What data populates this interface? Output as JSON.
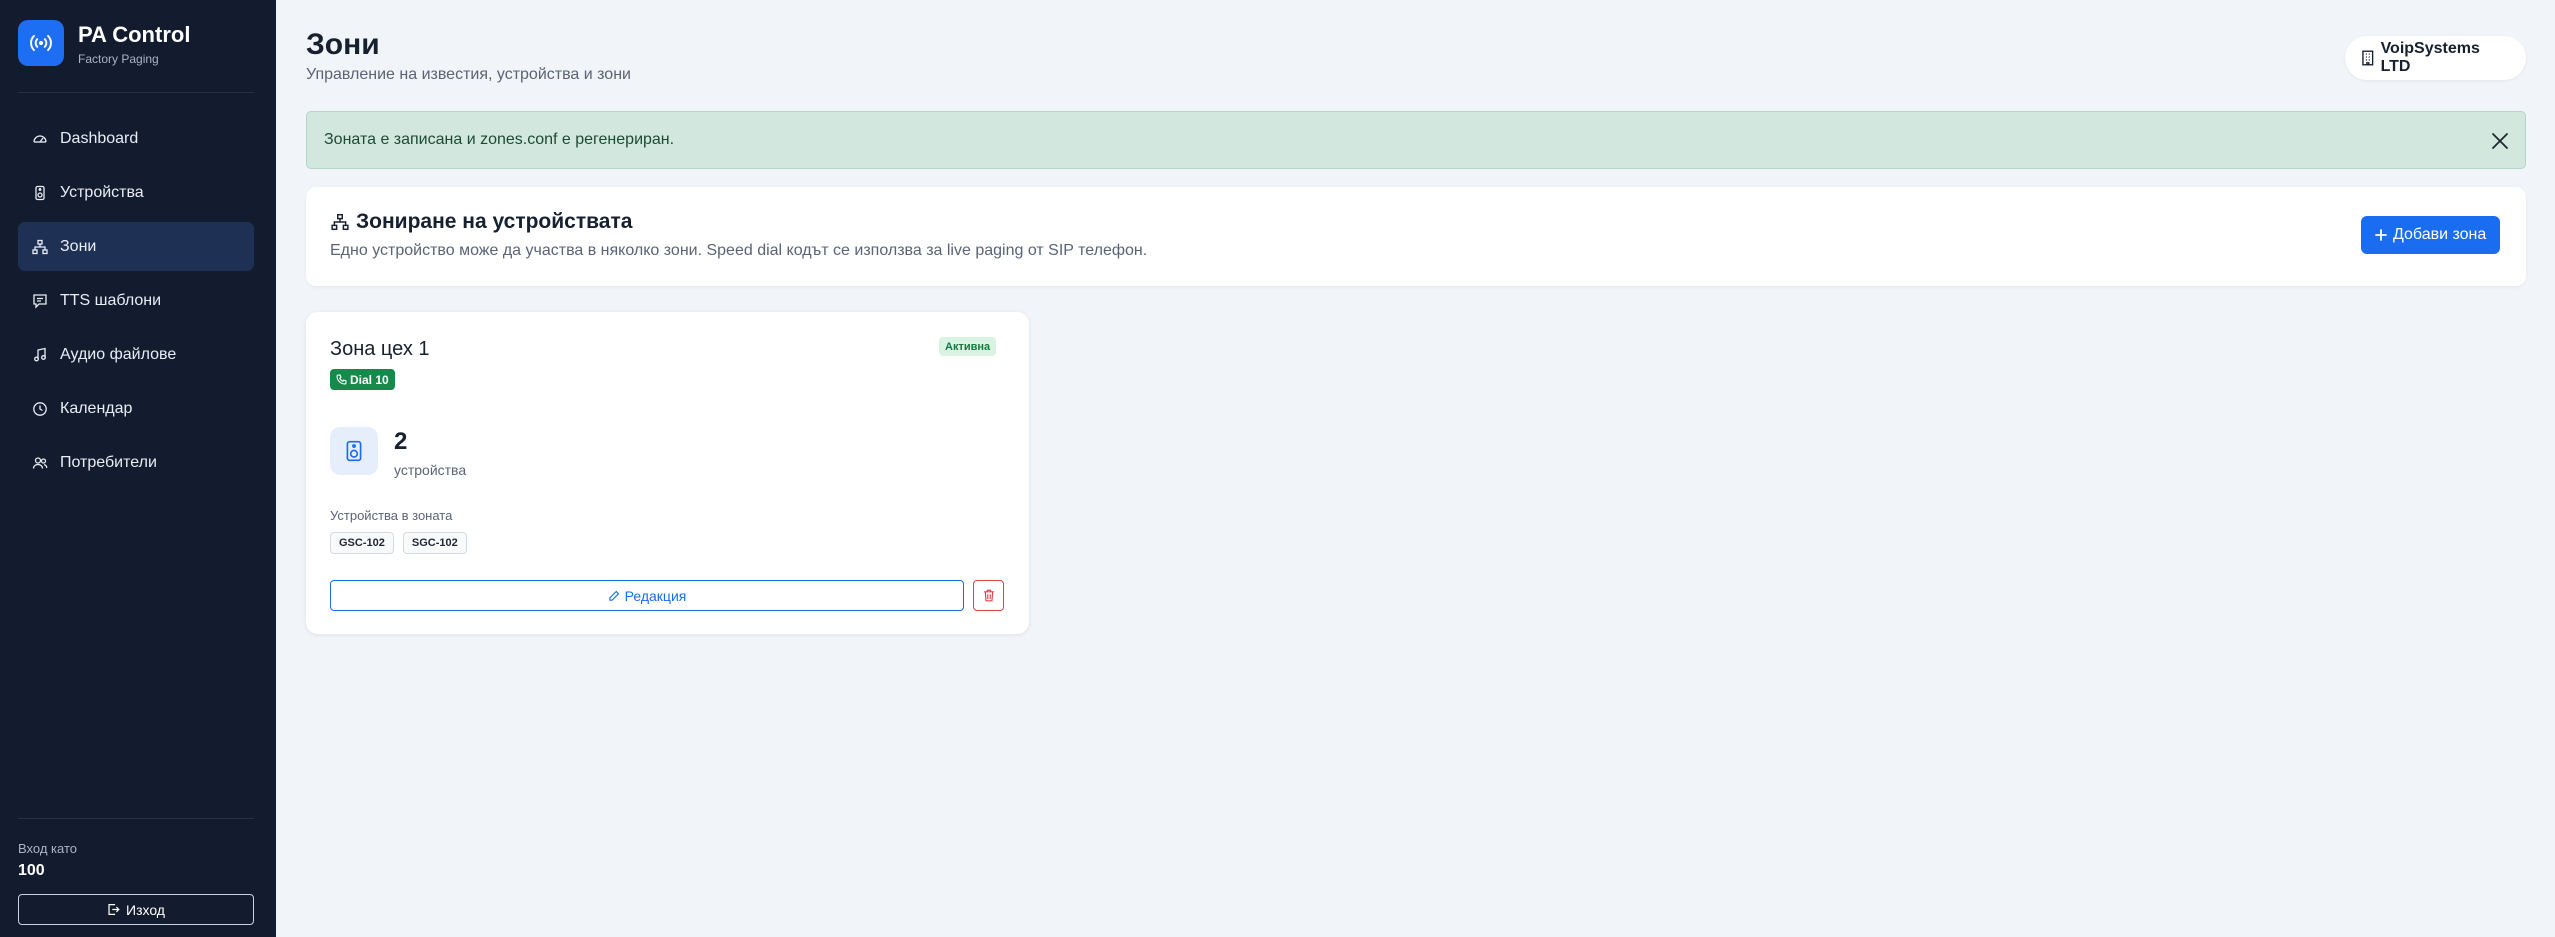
{
  "brand": {
    "title": "PA Control",
    "subtitle": "Factory Paging"
  },
  "sidebar": {
    "items": [
      {
        "label": "Dashboard",
        "icon": "gauge-icon",
        "active": false
      },
      {
        "label": "Устройства",
        "icon": "speaker-icon",
        "active": false
      },
      {
        "label": "Зони",
        "icon": "diagram-icon",
        "active": true
      },
      {
        "label": "TTS шаблони",
        "icon": "chat-icon",
        "active": false
      },
      {
        "label": "Аудио файлове",
        "icon": "music-note-icon",
        "active": false
      },
      {
        "label": "Календар",
        "icon": "clock-icon",
        "active": false
      },
      {
        "label": "Потребители",
        "icon": "users-icon",
        "active": false
      }
    ],
    "login_label": "Вход като",
    "login_user": "100",
    "logout_label": "Изход"
  },
  "header": {
    "title": "Зони",
    "subtitle": "Управление на известия, устройства и зони",
    "company": "VoipSystems LTD"
  },
  "alert": {
    "message": "Зоната е записана и zones.conf е регенериран."
  },
  "zoning": {
    "title": "Зониране на устройствата",
    "description": "Едно устройство може да участва в няколко зони. Speed dial кодът се използва за live paging от SIP телефон.",
    "add_label": "Добави зона"
  },
  "zones": [
    {
      "name": "Зона цех 1",
      "status": "Активна",
      "dial": "Dial 10",
      "device_count": "2",
      "device_count_label": "устройства",
      "devices_label": "Устройства в зоната",
      "devices": [
        "GSC-102",
        "SGC-102"
      ],
      "edit_label": "Редакция"
    }
  ],
  "colors": {
    "sidebar_bg": "#131c2e",
    "accent": "#1a6cf0",
    "success": "#168a4a",
    "danger": "#e0424c",
    "alert_bg": "#d2e8de"
  }
}
